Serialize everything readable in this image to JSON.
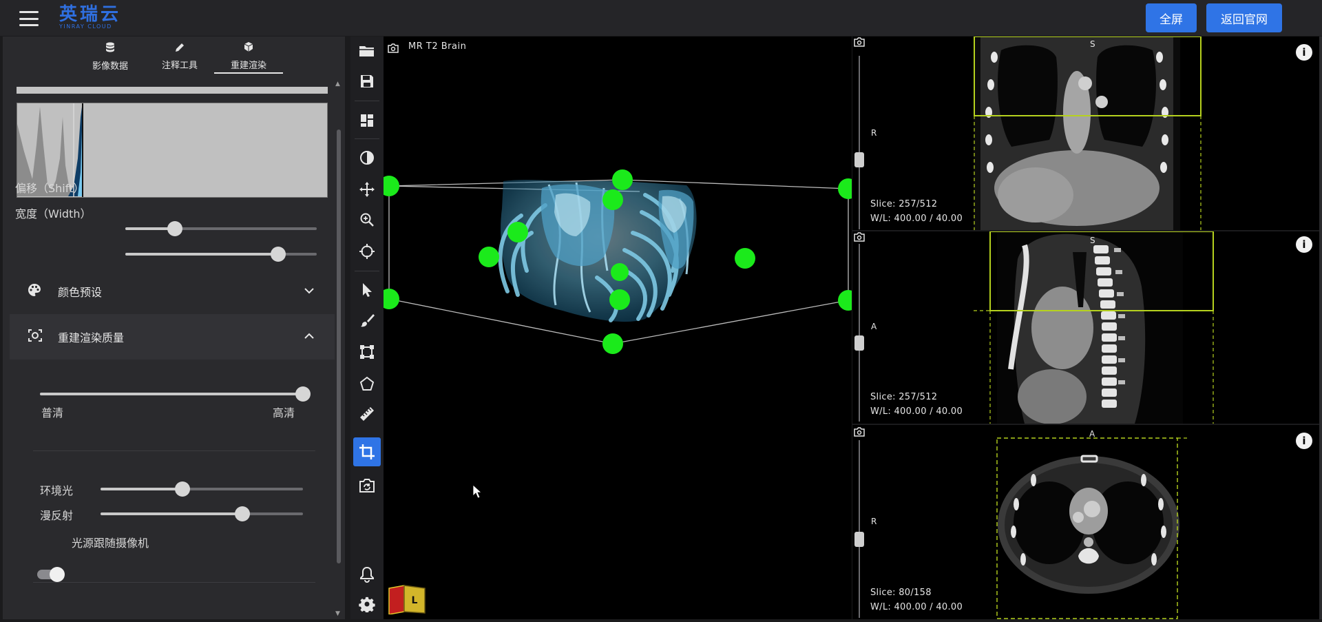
{
  "app": {
    "logo_name": "英瑞云",
    "logo_sub": "YINRAY CLOUD"
  },
  "header": {
    "fullscreen_label": "全屏",
    "home_label": "返回官网",
    "accent_color": "#2f74e6"
  },
  "left_panel": {
    "tabs": [
      {
        "icon": "database-icon",
        "label": "影像数据"
      },
      {
        "icon": "pencil-icon",
        "label": "注释工具"
      },
      {
        "icon": "cube-icon",
        "label": "重建渲染",
        "active": true
      }
    ],
    "shift": {
      "label": "偏移（Shift）",
      "value": 0.26
    },
    "width": {
      "label": "宽度（Width）",
      "value": 0.8
    },
    "color_preset": {
      "label": "颜色预设",
      "expanded": false
    },
    "render_quality": {
      "label": "重建渲染质量",
      "expanded": true,
      "value": 1.0,
      "min_label": "普清",
      "max_label": "高清"
    },
    "ambient_light": {
      "label": "环境光",
      "value": 0.41
    },
    "diffuse": {
      "label": "漫反射",
      "value": 0.7
    },
    "light_follow_camera": {
      "label": "光源跟随摄像机",
      "on": true
    }
  },
  "toolbar": {
    "tools": [
      {
        "name": "open-folder-icon"
      },
      {
        "name": "save-icon"
      },
      {
        "name": "layout-icon"
      },
      {
        "name": "contrast-icon"
      },
      {
        "name": "pan-icon"
      },
      {
        "name": "zoom-icon"
      },
      {
        "name": "crosshair-icon"
      },
      {
        "name": "pointer-icon"
      },
      {
        "name": "brush-icon"
      },
      {
        "name": "bounding-box-icon"
      },
      {
        "name": "polygon-icon"
      },
      {
        "name": "ruler-icon"
      },
      {
        "name": "crop-icon",
        "active": true
      },
      {
        "name": "camera-rotate-icon"
      },
      {
        "name": "bell-icon"
      },
      {
        "name": "settings-icon"
      }
    ]
  },
  "viewport_3d": {
    "title": "MR T2 Brain",
    "orientation_cube_faces": [
      "",
      "L"
    ],
    "handle_color": "#1bea1b",
    "render_color": "#7ec8e3"
  },
  "slices": [
    {
      "name": "coronal",
      "top_letter": "S",
      "side_letter": "R",
      "slice_label": "Slice: 257/512",
      "wl_label": "W/L: 400.00 / 40.00",
      "slider_pos": 0.5
    },
    {
      "name": "sagittal",
      "top_letter": "S",
      "side_letter": "A",
      "slice_label": "Slice: 257/512",
      "wl_label": "W/L: 400.00 / 40.00",
      "slider_pos": 0.5
    },
    {
      "name": "axial",
      "top_letter": "A",
      "side_letter": "R",
      "slice_label": "Slice: 80/158",
      "wl_label": "W/L: 400.00 / 40.00",
      "slider_pos": 0.5
    }
  ]
}
